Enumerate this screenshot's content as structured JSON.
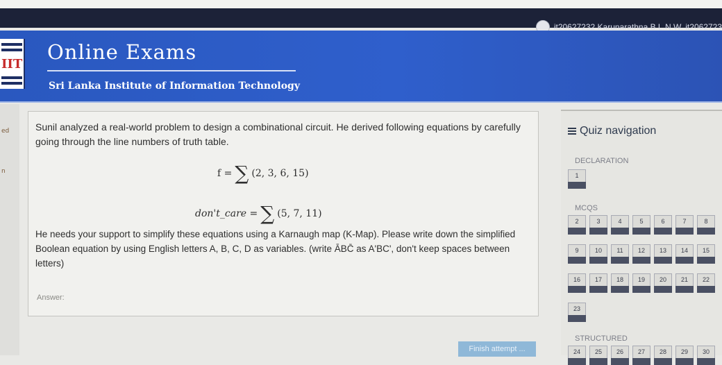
{
  "user": {
    "name": "it20627232 Karunarathna B.L.N.W. it2062723"
  },
  "header": {
    "logo_text": "IIT",
    "site_title": "Online Exams",
    "site_subtitle": "Sri Lanka Institute of Information Technology"
  },
  "left_edge": {
    "items": [
      "ed",
      "n"
    ]
  },
  "question": {
    "intro": "Sunil analyzed a real-world problem to design a combinational circuit. He derived following equations by carefully going through the line numbers of truth table.",
    "eq_f_lhs": "f =",
    "eq_f_sigma": "∑",
    "eq_f_set": "(2, 3, 6, 15)",
    "eq_dc_lhs": "don't_care =",
    "eq_dc_sigma": "∑",
    "eq_dc_set": "(5, 7, 11)",
    "instructions": "He needs your support to simplify these equations using a Karnaugh map (K-Map). Please write down the simplified Boolean equation by using English letters A, B, C, D as variables. (write ĀBC̄ as A'BC', don't keep spaces between letters)",
    "answer_label": "Answer:"
  },
  "quiz_navigation": {
    "title": "Quiz navigation",
    "sections": [
      {
        "label": "DECLARATION",
        "buttons": [
          "1"
        ]
      },
      {
        "label": "MCQS",
        "buttons": [
          "2",
          "3",
          "4",
          "5",
          "6",
          "7",
          "8",
          "9",
          "10",
          "11",
          "12",
          "13",
          "14",
          "15",
          "16",
          "17",
          "18",
          "19",
          "20",
          "21",
          "22",
          "23"
        ]
      },
      {
        "label": "STRUCTURED",
        "buttons": [
          "24",
          "25",
          "26",
          "27",
          "28",
          "29",
          "30"
        ]
      }
    ]
  },
  "footer": {
    "finish_label": "Finish attempt ..."
  }
}
